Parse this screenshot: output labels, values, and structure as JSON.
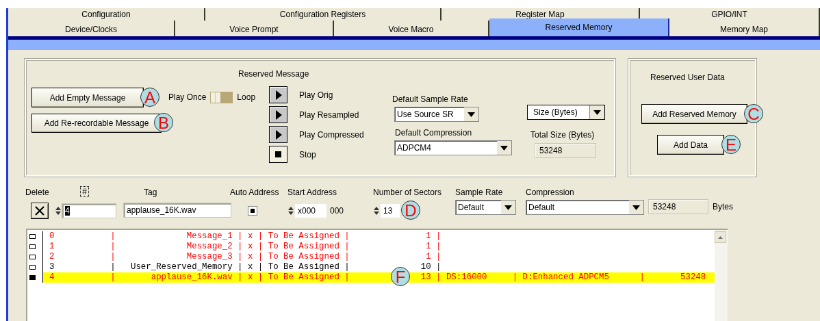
{
  "tabs_row_1": [
    {
      "label": "Configuration",
      "selected": false
    },
    {
      "label": "Configuration Registers",
      "selected": false
    },
    {
      "label": "Register Map",
      "selected": false
    },
    {
      "label": "GPIO/INT",
      "selected": false
    }
  ],
  "tabs_row_2": [
    {
      "label": "Device/Clocks",
      "selected": false
    },
    {
      "label": "Voice Prompt",
      "selected": false
    },
    {
      "label": "Voice Macro",
      "selected": false
    },
    {
      "label": "Reserved Memory",
      "selected": true
    },
    {
      "label": "Memory Map",
      "selected": false
    }
  ],
  "reserved_message": {
    "title": "Reserved Message",
    "buttons": [
      {
        "label": "Add Empty Message",
        "callout": "A"
      },
      {
        "label": "Add Re-recordable Message",
        "callout": "B"
      }
    ],
    "mode": {
      "left_label": "Play Once",
      "right_label": "Loop",
      "loop": false
    },
    "playback": [
      {
        "kind": "play",
        "label": "Play Orig"
      },
      {
        "kind": "play",
        "label": "Play Resampled"
      },
      {
        "kind": "play",
        "label": "Play Compressed"
      },
      {
        "kind": "stop",
        "label": "Stop"
      }
    ],
    "default_sample_rate": {
      "label": "Default Sample Rate",
      "value": "Use Source SR"
    },
    "default_compression": {
      "label": "Default Compression",
      "value": "ADPCM4"
    },
    "size_unit": {
      "value": "Size (Bytes)"
    },
    "total_size": {
      "label": "Total Size (Bytes)",
      "value": "53248"
    }
  },
  "reserved_user_data": {
    "title": "Reserved User Data",
    "buttons": [
      {
        "label": "Add Reserved Memory",
        "callout": "C"
      },
      {
        "label": "Add Data",
        "callout": "E"
      }
    ]
  },
  "editor": {
    "delete_label": "Delete",
    "index_label": "#",
    "index_value": "4",
    "tag_label": "Tag",
    "tag_value": "applause_16K.wav",
    "auto_address_label": "Auto Address",
    "auto_address": true,
    "start_address_label": "Start Address",
    "start_address_value": "x000",
    "start_address_suffix": "000",
    "sectors_label": "Number of Sectors",
    "sectors_value": "13",
    "sectors_callout": "D",
    "sample_rate_label": "Sample Rate",
    "sample_rate_value": "Default",
    "compression_label": "Compression",
    "compression_value": "Default",
    "size_value": "53248",
    "size_unit": "Bytes"
  },
  "list": {
    "callout": "F",
    "rows": [
      {
        "text": "0           |              Message_1 | x | To Be Assigned |               1 |",
        "kind": "message",
        "selected": false
      },
      {
        "text": "1           |              Message_2 | x | To Be Assigned |               1 |",
        "kind": "message",
        "selected": false
      },
      {
        "text": "2           |              Message_3 | x | To Be Assigned |               1 |",
        "kind": "message",
        "selected": false
      },
      {
        "text": "3           |   User_Reserved_Memory | x | To Be Assigned |              10 |",
        "kind": "user_data",
        "selected": false
      },
      {
        "text": "4           |       applause_16K.wav | x | To Be Assigned |              13 | DS:16000     | D:Enhanced ADPCM5      |       53248",
        "kind": "message",
        "selected": true
      }
    ]
  }
}
